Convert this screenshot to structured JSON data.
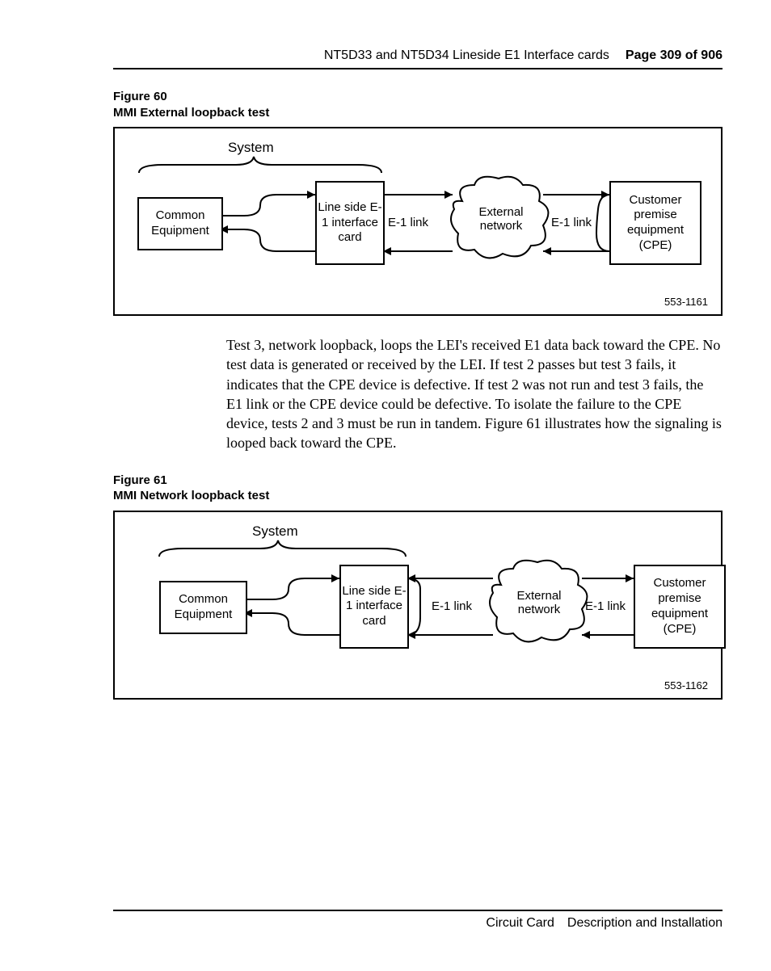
{
  "header": {
    "title": "NT5D33 and NT5D34 Lineside E1 Interface cards",
    "page": "Page 309 of 906"
  },
  "figure60": {
    "number": "Figure 60",
    "title": "MMI External loopback test",
    "systemLabel": "System",
    "commonEquipment": "Common Equipment",
    "lineCard": "Line side E-1 interface card",
    "e1link1": "E-1 link",
    "externalNetwork": "External network",
    "e1link2": "E-1 link",
    "cpe": "Customer premise equipment (CPE)",
    "ref": "553-1161"
  },
  "bodyText": "Test 3, network loopback, loops the LEI's received E1 data back toward the CPE. No test data is generated or received by the LEI. If test 2 passes but test 3 fails, it indicates that the CPE device is defective. If test 2 was not run and test 3 fails, the E1 link or the CPE device could be defective. To isolate the failure to the CPE device, tests 2 and 3 must be run in tandem. Figure 61 illustrates how the signaling is looped back toward the CPE.",
  "figure61": {
    "number": "Figure 61",
    "title": "MMI Network loopback test",
    "systemLabel": "System",
    "commonEquipment": "Common Equipment",
    "lineCard": "Line side E-1 interface card",
    "e1link1": "E-1 link",
    "externalNetwork": "External network",
    "e1link2": "E-1 link",
    "cpe": "Customer premise equipment (CPE)",
    "ref": "553-1162"
  },
  "footer": "Circuit Card Description and Installation"
}
